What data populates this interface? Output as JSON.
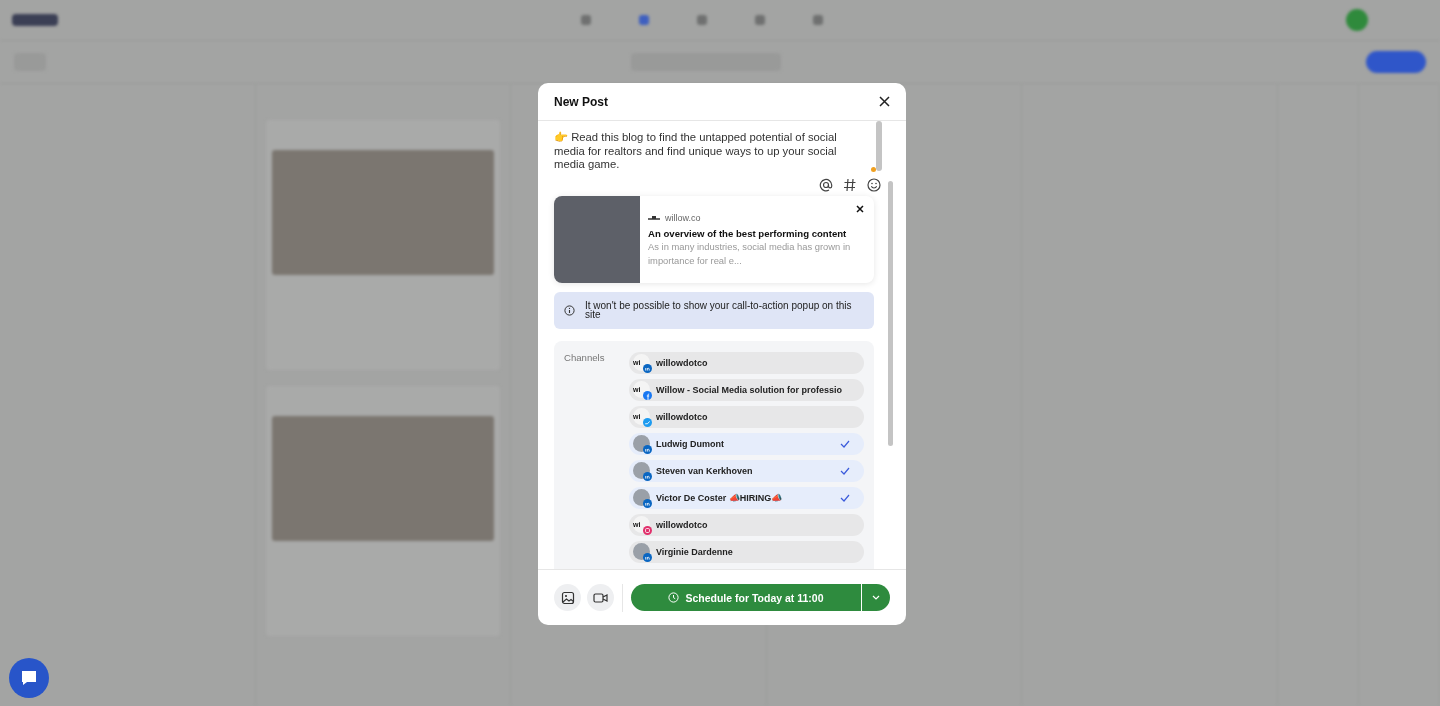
{
  "modal": {
    "title": "New Post",
    "message": "👉 Read this blog to find the untapped potential of social media for realtors and find unique ways to up your social media game.",
    "link_preview": {
      "domain": "willow.co",
      "title": "An overview of the best performing content",
      "description": "As in many industries, social media has grown in importance for real e..."
    },
    "notice": "It won't be possible to show your call-to-action popup on this site",
    "channels_label": "Channels",
    "channels": [
      {
        "name": "willowdotco",
        "kind": "linkedin",
        "logo_text": "wi",
        "selected": false
      },
      {
        "name": "Willow - Social Media solution for professio",
        "kind": "facebook",
        "logo_text": "wi",
        "selected": false
      },
      {
        "name": "willowdotco",
        "kind": "twitter",
        "logo_text": "wi",
        "selected": false
      },
      {
        "name": "Ludwig Dumont",
        "kind": "linkedin",
        "selected": true
      },
      {
        "name": "Steven van Kerkhoven",
        "kind": "linkedin",
        "selected": true
      },
      {
        "name": "Victor De Coster 📣HIRING📣",
        "kind": "linkedin",
        "selected": true
      },
      {
        "name": "willowdotco",
        "kind": "instagram",
        "logo_text": "wi",
        "selected": false
      },
      {
        "name": "Virginie Dardenne",
        "kind": "linkedin",
        "selected": false
      }
    ],
    "schedule_button": "Schedule for Today at 11:00"
  }
}
